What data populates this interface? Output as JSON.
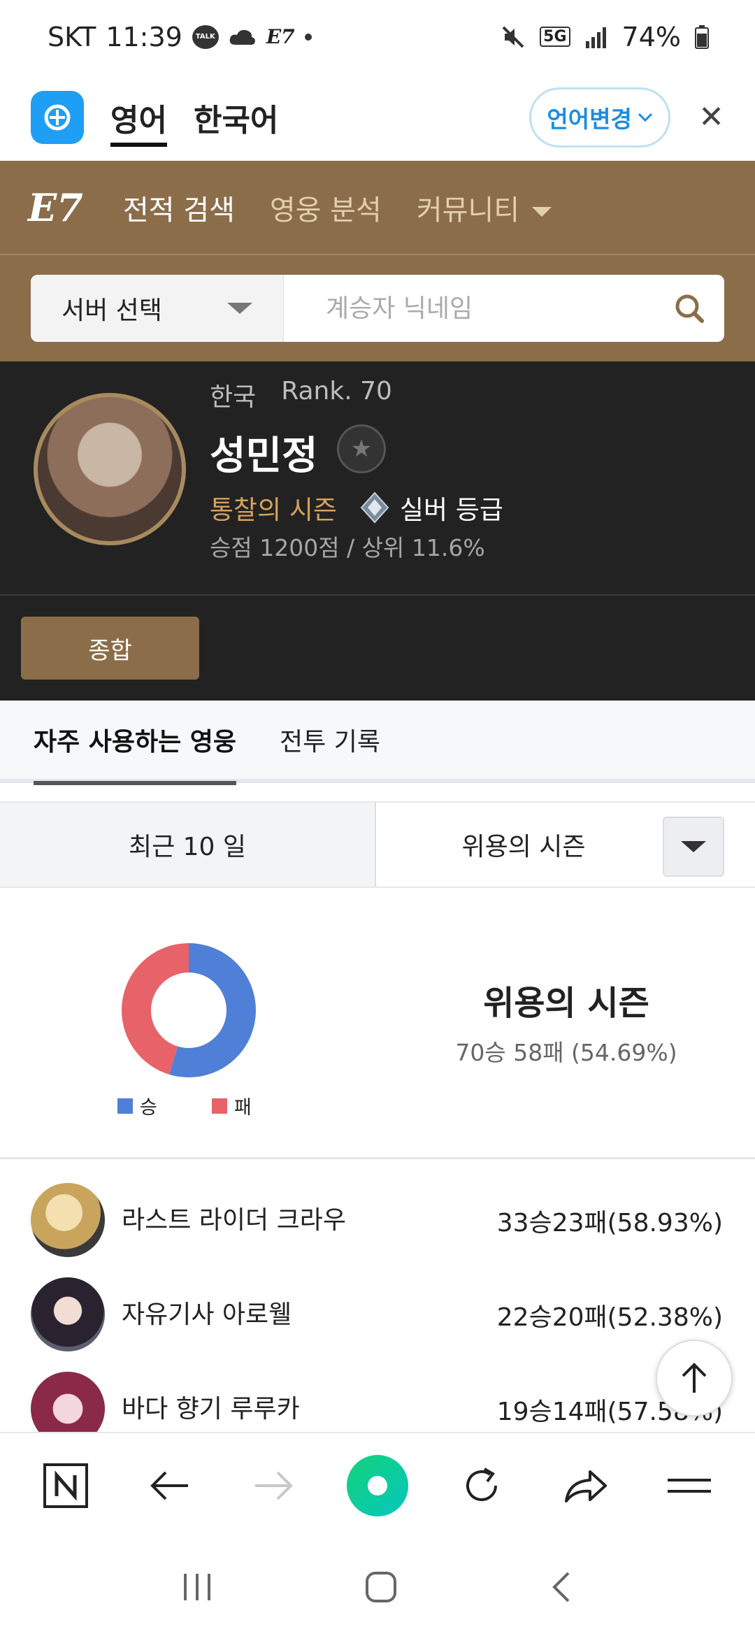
{
  "status_bar": {
    "carrier": "SKT",
    "time": "11:39",
    "talk_badge": "TALK",
    "network": "5G",
    "battery": "74%"
  },
  "translate_bar": {
    "tab_english": "영어",
    "tab_korean": "한국어",
    "change_language": "언어변경"
  },
  "site_nav": {
    "items": [
      {
        "label": "전적 검색"
      },
      {
        "label": "영웅 분석"
      },
      {
        "label": "커뮤니티"
      }
    ]
  },
  "search": {
    "server_label": "서버 선택",
    "placeholder": "계승자 닉네임"
  },
  "profile": {
    "region": "한국",
    "rank": "Rank. 70",
    "name": "성민정",
    "season": "통찰의 시즌",
    "grade": "실버 등급",
    "points": "승점 1200점 / 상위 11.6%"
  },
  "summary_button": "종합",
  "sub_tabs": [
    {
      "label": "자주 사용하는 영웅"
    },
    {
      "label": "전투 기록"
    }
  ],
  "period": {
    "recent": "최근 10 일",
    "season": "위용의 시즌"
  },
  "chart_data": {
    "type": "pie",
    "categories": [
      "승",
      "패"
    ],
    "values": [
      70,
      58
    ],
    "colors": [
      "#4f7fd6",
      "#e76369"
    ],
    "legend_position": "bottom"
  },
  "season_summary": {
    "title": "위용의 시즌",
    "record": "70승 58패 (54.69%)"
  },
  "heroes": [
    {
      "name": "라스트 라이더 크라우",
      "record": "33승23패(58.93%)"
    },
    {
      "name": "자유기사 아로웰",
      "record": "22승20패(52.38%)"
    },
    {
      "name": "바다 향기 루루카",
      "record": "19승14패(57.58%)"
    }
  ]
}
